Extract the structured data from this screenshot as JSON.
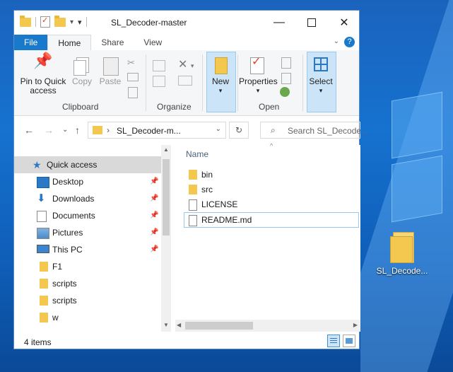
{
  "window": {
    "title": "SL_Decoder-master",
    "minimize_icon": "minimize-icon",
    "maximize_icon": "maximize-icon",
    "close_icon": "close-icon"
  },
  "tabs": {
    "file": "File",
    "home": "Home",
    "share": "Share",
    "view": "View"
  },
  "ribbon": {
    "clipboard": {
      "pin_label_1": "Pin to Quick",
      "pin_label_2": "access",
      "copy": "Copy",
      "paste": "Paste",
      "group": "Clipboard"
    },
    "organize": {
      "group": "Organize"
    },
    "new": {
      "label": "New"
    },
    "open": {
      "properties": "Properties",
      "group": "Open"
    },
    "select": {
      "label": "Select"
    }
  },
  "address": {
    "path": "SL_Decoder-m...",
    "search_placeholder": "Search SL_Decode..."
  },
  "navpane": {
    "items": [
      {
        "label": "Quick access",
        "icon": "star-icon",
        "pinned": false
      },
      {
        "label": "Desktop",
        "icon": "desktop-icon",
        "pinned": true
      },
      {
        "label": "Downloads",
        "icon": "download-icon",
        "pinned": true
      },
      {
        "label": "Documents",
        "icon": "documents-icon",
        "pinned": true
      },
      {
        "label": "Pictures",
        "icon": "pictures-icon",
        "pinned": true
      },
      {
        "label": "This PC",
        "icon": "computer-icon",
        "pinned": true
      },
      {
        "label": "F1",
        "icon": "folder-icon",
        "pinned": false
      },
      {
        "label": "scripts",
        "icon": "folder-icon",
        "pinned": false
      },
      {
        "label": "scripts",
        "icon": "folder-icon",
        "pinned": false
      },
      {
        "label": "w",
        "icon": "folder-icon",
        "pinned": false
      }
    ]
  },
  "content": {
    "column_name": "Name",
    "files": [
      {
        "name": "bin",
        "type": "folder"
      },
      {
        "name": "src",
        "type": "folder"
      },
      {
        "name": "LICENSE",
        "type": "file"
      },
      {
        "name": "README.md",
        "type": "markdown",
        "selected": true
      }
    ]
  },
  "status": {
    "count": "4 items"
  },
  "desktop": {
    "icon_label": "SL_Decode..."
  },
  "colors": {
    "accent": "#1979ca",
    "folder": "#f4c84e",
    "selection": "#cce4f7",
    "desktop": "#1672cf"
  }
}
